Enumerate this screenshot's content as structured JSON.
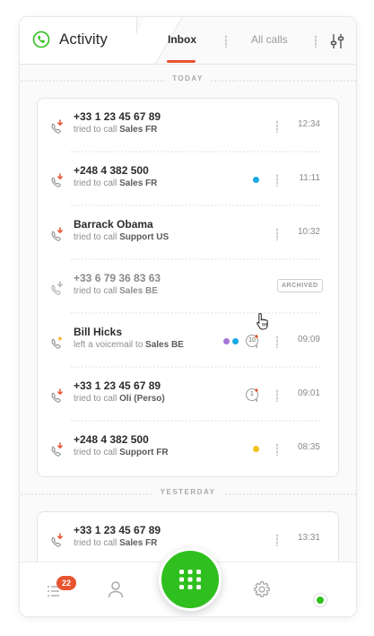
{
  "app": {
    "title": "Activity"
  },
  "tabs": [
    {
      "label": "Inbox",
      "active": true
    },
    {
      "label": "All calls",
      "active": false
    }
  ],
  "sections": {
    "today": "TODAY",
    "yesterday": "YESTERDAY"
  },
  "today_calls": [
    {
      "caller": "+33 1 23 45 67 89",
      "action": "tried to call",
      "target": "Sales FR",
      "time": "12:34",
      "type": "missed"
    },
    {
      "caller": "+248 4 382 500",
      "action": "tried to call",
      "target": "Sales FR",
      "time": "11:11",
      "type": "missed",
      "tag_colors": [
        "#19a9e6"
      ]
    },
    {
      "caller": "Barrack Obama",
      "action": "tried to call",
      "target": "Support US",
      "time": "10:32",
      "type": "missed"
    },
    {
      "caller": "+33 6 79 36 83 63",
      "action": "tried to call",
      "target": "Sales BE",
      "time": "",
      "type": "archived",
      "badge": "ARCHIVED"
    },
    {
      "caller": "Bill Hicks",
      "action": "left a voicemail to",
      "target": "Sales BE",
      "time": "09:09",
      "type": "voicemail",
      "tag_colors": [
        "#a678d8",
        "#19a9e6"
      ],
      "comments": "10"
    },
    {
      "caller": "+33 1 23 45 67 89",
      "action": "tried to call",
      "target": "Oli (Perso)",
      "time": "09:01",
      "type": "missed",
      "comments": "1"
    },
    {
      "caller": "+248 4 382 500",
      "action": "tried to call",
      "target": "Support FR",
      "time": "08:35",
      "type": "missed",
      "tag_colors": [
        "#f2c21b"
      ]
    }
  ],
  "yesterday_calls": [
    {
      "caller": "+33 1 23 45 67 89",
      "action": "tried to call",
      "target": "Sales FR",
      "time": "13:31",
      "type": "missed"
    }
  ],
  "bottom_nav": {
    "notifications_count": "22"
  },
  "colors": {
    "accent": "#e8542f",
    "green": "#2fbf1e"
  }
}
